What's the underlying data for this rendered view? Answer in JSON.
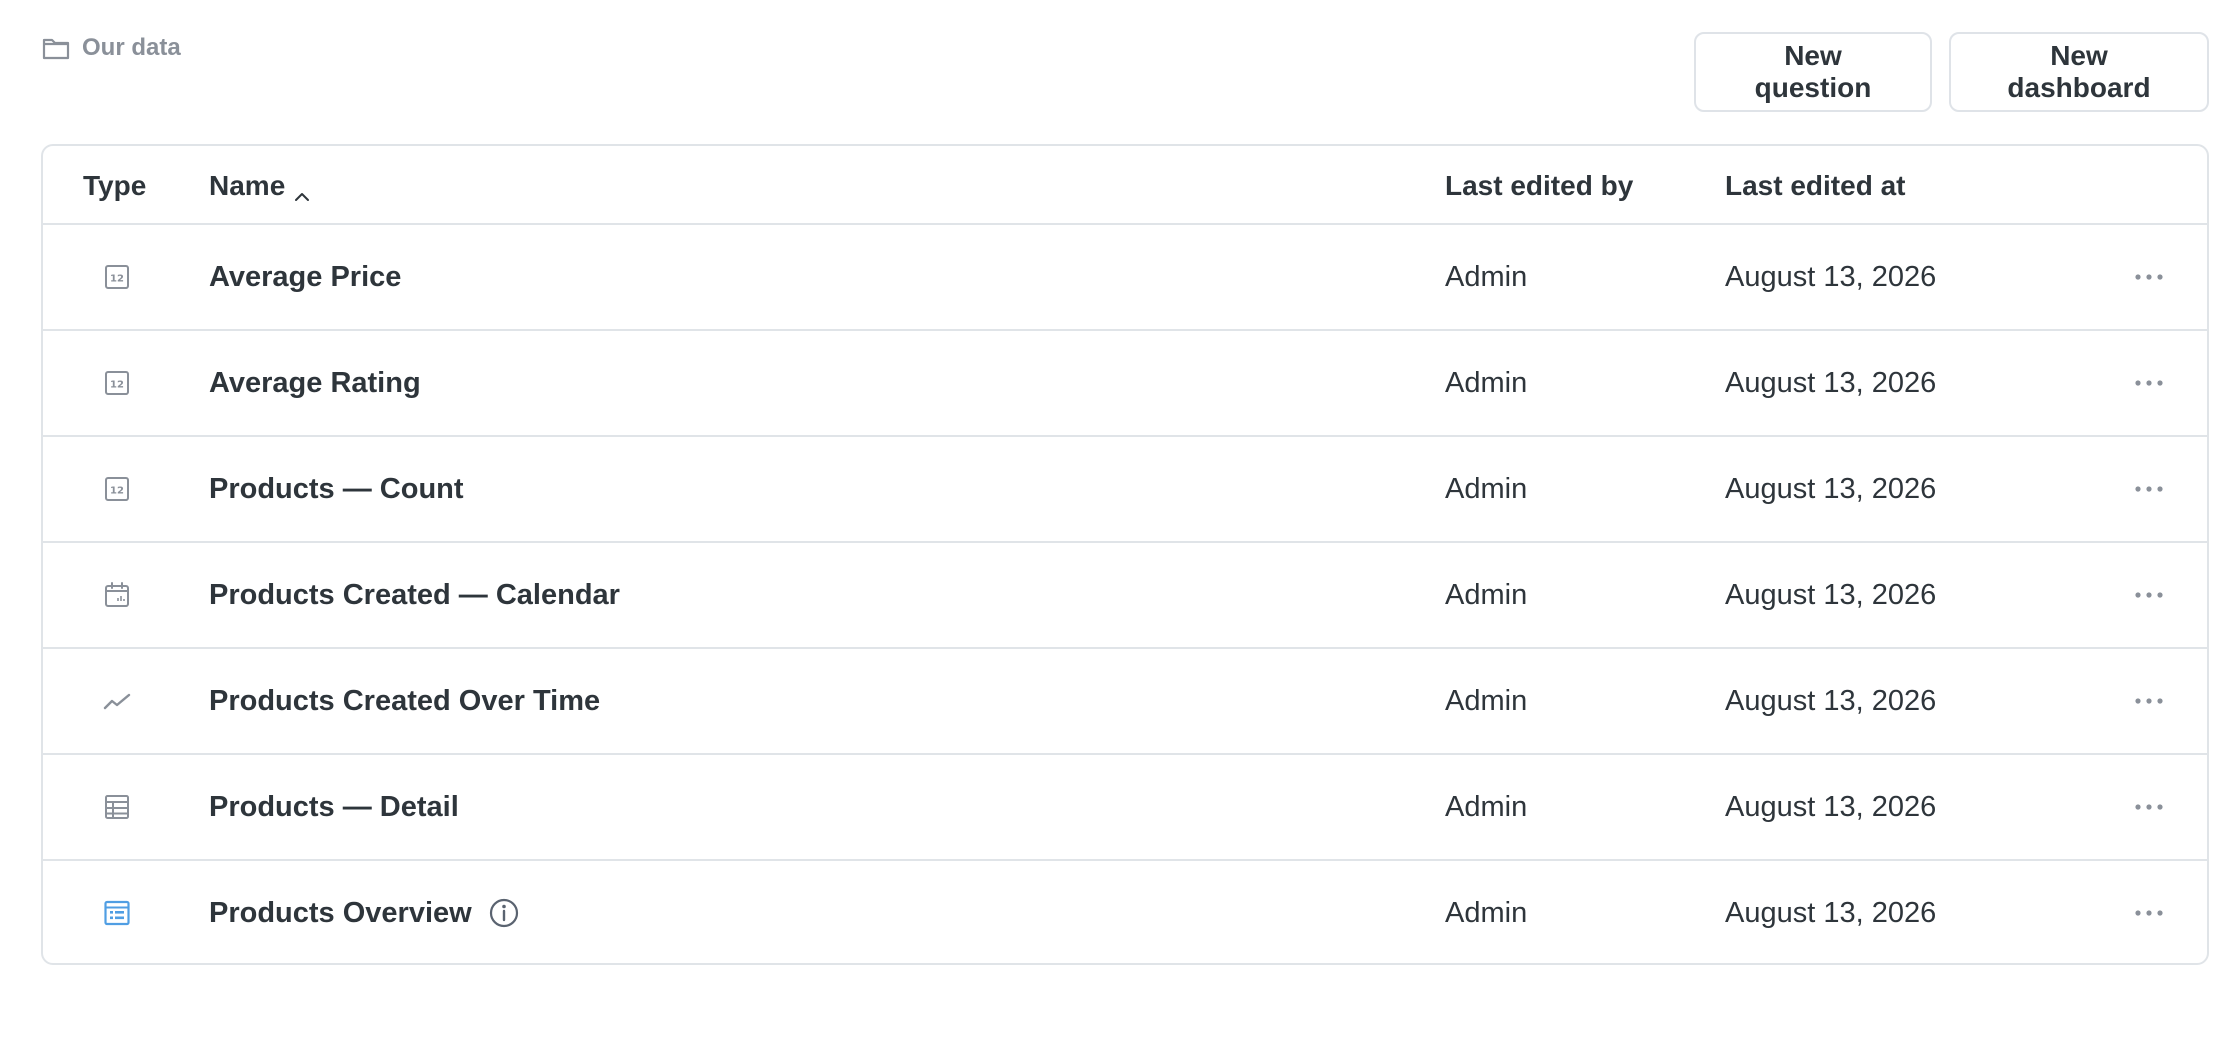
{
  "breadcrumb": {
    "label": "Our data",
    "icon": "folder-icon"
  },
  "actions": {
    "new_question": "New question",
    "new_dashboard": "New dashboard"
  },
  "table": {
    "columns": {
      "type": "Type",
      "name": "Name",
      "last_edited_by": "Last edited by",
      "last_edited_at": "Last edited at"
    },
    "sort": {
      "column": "name",
      "direction": "ascending"
    },
    "rows": [
      {
        "icon": "number-icon",
        "name": "Average Price",
        "edited_by": "Admin",
        "edited_at": "August 13, 2026"
      },
      {
        "icon": "number-icon",
        "name": "Average Rating",
        "edited_by": "Admin",
        "edited_at": "August 13, 2026"
      },
      {
        "icon": "number-icon",
        "name": "Products — Count",
        "edited_by": "Admin",
        "edited_at": "August 13, 2026"
      },
      {
        "icon": "calendar-icon",
        "name": "Products Created — Calendar",
        "edited_by": "Admin",
        "edited_at": "August 13, 2026"
      },
      {
        "icon": "line-chart-icon",
        "name": "Products Created Over Time",
        "edited_by": "Admin",
        "edited_at": "August 13, 2026"
      },
      {
        "icon": "table-icon",
        "name": "Products — Detail",
        "edited_by": "Admin",
        "edited_at": "August 13, 2026"
      },
      {
        "icon": "dashboard-icon",
        "name": "Products Overview",
        "edited_by": "Admin",
        "edited_at": "August 13, 2026",
        "has_info": true
      }
    ]
  },
  "colors": {
    "text": "#2e353b",
    "muted": "#8a9099",
    "border": "#e0e4e8",
    "accent": "#509ee3"
  }
}
